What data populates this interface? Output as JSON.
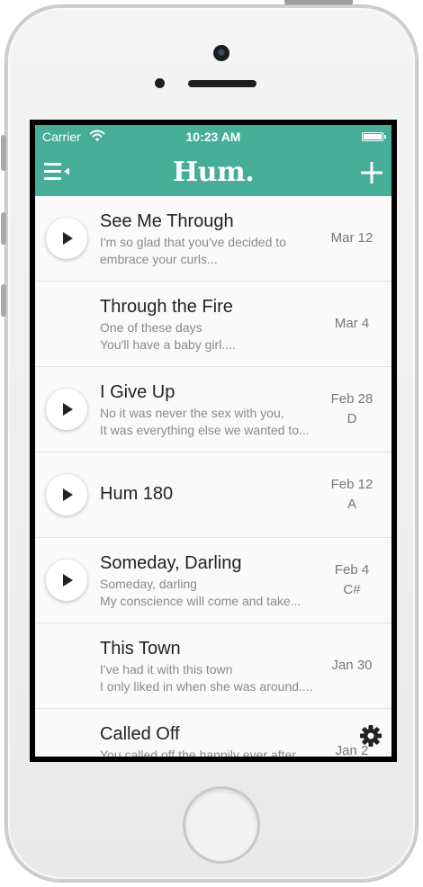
{
  "status_bar": {
    "carrier": "Carrier",
    "time": "10:23 AM"
  },
  "nav": {
    "brand": "Hum.",
    "menu_icon": "menu-icon",
    "add_icon": "plus-icon"
  },
  "songs": [
    {
      "title": "See Me Through",
      "lines": [
        "I'm so glad that you've decided to",
        "embrace your curls..."
      ],
      "date": "Mar 12",
      "key": "",
      "playable": true
    },
    {
      "title": "Through the Fire",
      "lines": [
        "One of these days",
        "You'll have a baby girl...."
      ],
      "date": "Mar 4",
      "key": "",
      "playable": false
    },
    {
      "title": "I Give Up",
      "lines": [
        "No it was never the sex with you,",
        "It was everything else we wanted to..."
      ],
      "date": "Feb 28",
      "key": "D",
      "playable": true
    },
    {
      "title": "Hum 180",
      "lines": [],
      "date": "Feb 12",
      "key": "A",
      "playable": true
    },
    {
      "title": "Someday, Darling",
      "lines": [
        "Someday, darling",
        "My conscience will come and take..."
      ],
      "date": "Feb 4",
      "key": "C#",
      "playable": true
    },
    {
      "title": "This Town",
      "lines": [
        "I've had it with this town",
        "I only liked in when she was around...."
      ],
      "date": "Jan 30",
      "key": "",
      "playable": false
    },
    {
      "title": "Called Off",
      "lines": [
        "You called off the happily ever after",
        ""
      ],
      "date": "Jan 2",
      "key": "",
      "playable": false
    }
  ],
  "footer": {
    "settings_icon": "gear-icon"
  },
  "colors": {
    "accent": "#46ad98",
    "background": "#fafafa"
  }
}
